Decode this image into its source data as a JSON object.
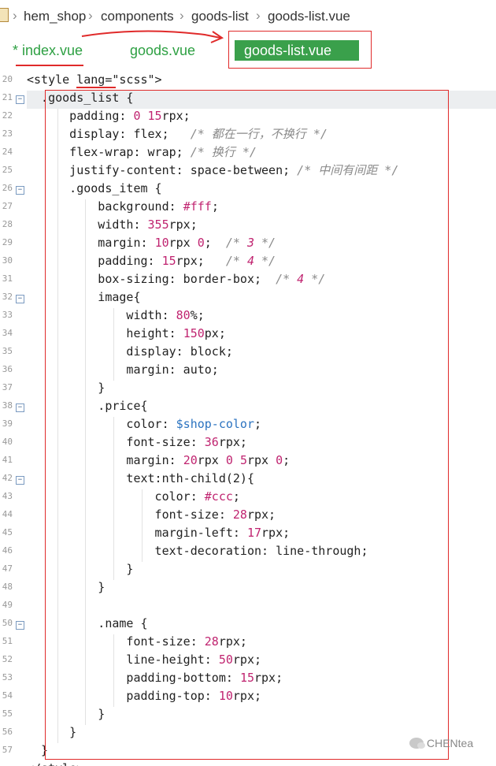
{
  "breadcrumb": {
    "items": [
      "hem_shop",
      "components",
      "goods-list",
      "goods-list.vue"
    ],
    "separator": "›"
  },
  "tabs": {
    "items": [
      {
        "label": "* index.vue",
        "active": false
      },
      {
        "label": "goods.vue",
        "active": false
      },
      {
        "label": "goods-list.vue",
        "active": true
      }
    ]
  },
  "editor": {
    "line_numbers": [
      "20",
      "21",
      "22",
      "23",
      "24",
      "25",
      "26",
      "27",
      "28",
      "29",
      "30",
      "31",
      "32",
      "33",
      "34",
      "35",
      "36",
      "37",
      "38",
      "39",
      "40",
      "41",
      "42",
      "43",
      "44",
      "45",
      "46",
      "47",
      "48",
      "49",
      "50",
      "51",
      "52",
      "53",
      "54",
      "55",
      "56",
      "57"
    ],
    "lines": [
      "<style lang=\"scss\">",
      "  .goods_list {",
      "      padding: 0 15rpx;",
      "      display: flex;   /* 都在一行，不换行 */",
      "      flex-wrap: wrap; /* 换行 */",
      "      justify-content: space-between; /* 中间有间距 */",
      "      .goods_item {",
      "          background: #fff;",
      "          width: 355rpx;",
      "          margin: 10rpx 0;  /* 3 */",
      "          padding: 15rpx;   /* 4 */",
      "          box-sizing: border-box;  /* 4 */",
      "          image{",
      "              width: 80%;",
      "              height: 150px;",
      "              display: block;",
      "              margin: auto;",
      "          }",
      "          .price{",
      "              color: $shop-color;",
      "              font-size: 36rpx;",
      "              margin: 20rpx 0 5rpx 0;",
      "              text:nth-child(2){",
      "                  color: #ccc;",
      "                  font-size: 28rpx;",
      "                  margin-left: 17rpx;",
      "                  text-decoration: line-through;",
      "              }",
      "          }",
      "",
      "          .name {",
      "              font-size: 28rpx;",
      "              line-height: 50rpx;",
      "              padding-bottom: 15rpx;",
      "              padding-top: 10rpx;",
      "          }",
      "      }",
      "  }"
    ],
    "next_line_partial": "</style>"
  },
  "watermark": {
    "text": "CHENtea"
  },
  "colors": {
    "tab_active_bg": "#3aa04b",
    "tab_text": "#2ea043",
    "annotation_red": "#e02a2a"
  }
}
